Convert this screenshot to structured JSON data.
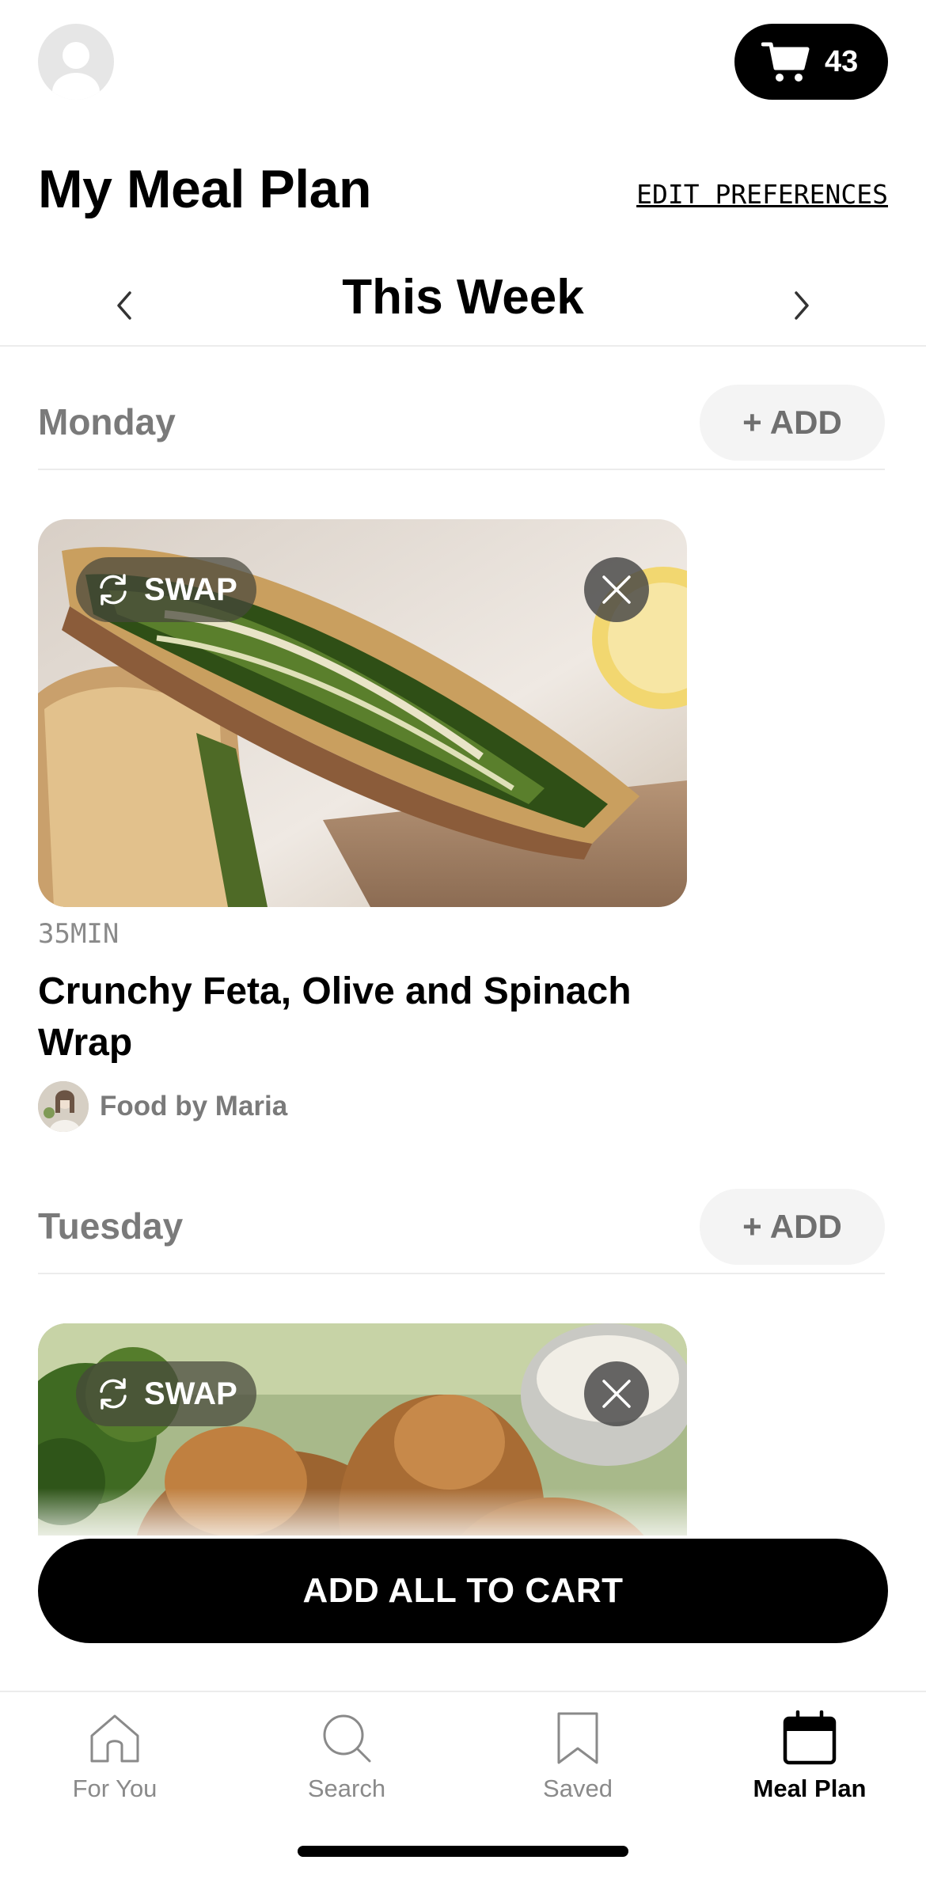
{
  "header": {
    "avatar_icon": "user-avatar-icon",
    "cart_icon": "shopping-cart-icon",
    "cart_count": "43"
  },
  "title": "My Meal Plan",
  "edit_preferences_label": "EDIT PREFERENCES",
  "week_nav": {
    "label": "This Week",
    "prev_icon": "chevron-left-icon",
    "next_icon": "chevron-right-icon"
  },
  "days": [
    {
      "day": "Monday",
      "add_label": "+ ADD",
      "meal": {
        "swap_label": "SWAP",
        "time": "35MIN",
        "title": "Crunchy Feta, Olive and Spinach Wrap",
        "author": "Food by Maria",
        "image": "spinach-wrap-photo"
      }
    },
    {
      "day": "Tuesday",
      "add_label": "+ ADD",
      "meal": {
        "swap_label": "SWAP",
        "image": "chicken-wings-photo"
      }
    }
  ],
  "cta_label": "ADD ALL TO CART",
  "tabs": [
    {
      "label": "For You",
      "icon": "home-icon",
      "active": false
    },
    {
      "label": "Search",
      "icon": "search-icon",
      "active": false
    },
    {
      "label": "Saved",
      "icon": "bookmark-icon",
      "active": false
    },
    {
      "label": "Meal Plan",
      "icon": "calendar-icon",
      "active": true
    }
  ],
  "colors": {
    "accent": "#000000",
    "muted_text": "#7a7a7a",
    "pill_bg": "#f4f4f4"
  }
}
